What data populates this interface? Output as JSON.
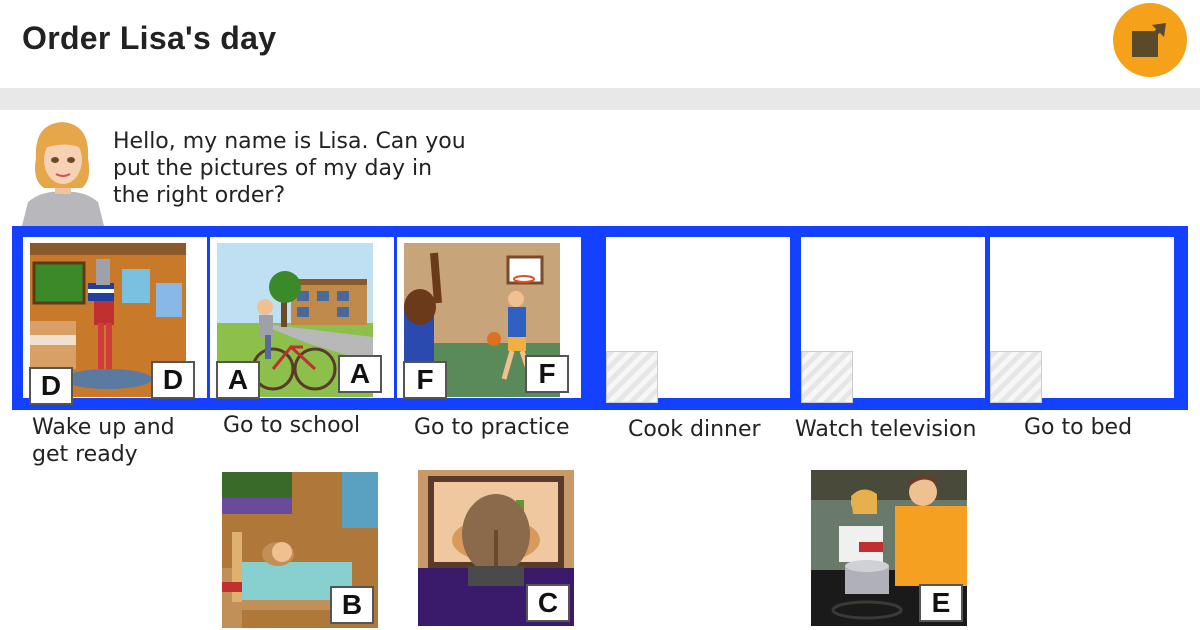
{
  "header": {
    "title": "Order Lisa's day",
    "share_icon": "external-link-icon",
    "accent": "#f5a11a"
  },
  "intro": {
    "text": "Hello, my name is Lisa. Can you put the pictures of my day in the right order?"
  },
  "strip_color": "#1441ff",
  "slots": [
    {
      "label": "Wake up and get ready",
      "card": "D"
    },
    {
      "label": "Go to school",
      "card": "A"
    },
    {
      "label": "Go to practice",
      "card": "F"
    },
    {
      "label": "Cook dinner",
      "card": ""
    },
    {
      "label": "Watch television",
      "card": ""
    },
    {
      "label": "Go to bed",
      "card": ""
    }
  ],
  "cards": [
    {
      "letter": "B",
      "scene": "sleeping-in-bed"
    },
    {
      "letter": "C",
      "scene": "watching-television"
    },
    {
      "letter": "E",
      "scene": "cooking-dinner"
    }
  ]
}
